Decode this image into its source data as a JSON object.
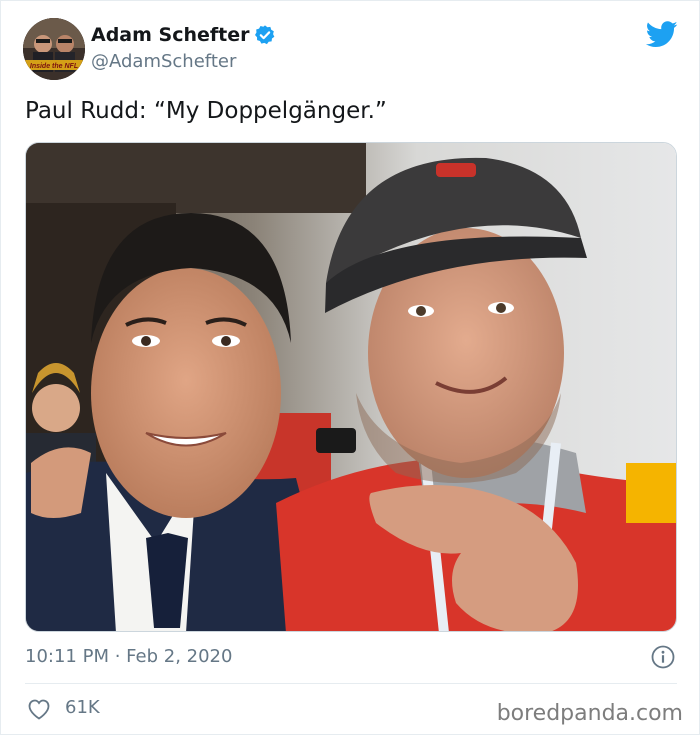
{
  "tweet": {
    "display_name": "Adam Schefter",
    "verified": true,
    "handle": "@AdamSchefter",
    "text": "Paul Rudd: “My Doppelgänger.”",
    "timestamp": "10:11 PM · Feb 2, 2020",
    "like_count": "61K",
    "avatar_logo_text": "Inside the NFL"
  },
  "icons": {
    "brand": "twitter-bird-icon",
    "verified": "verified-badge-icon",
    "info": "info-icon",
    "like": "heart-icon"
  },
  "colors": {
    "twitter_blue": "#1da1f2",
    "text_primary": "#14171a",
    "text_secondary": "#657786"
  },
  "watermark": {
    "text": "boredpanda.com"
  }
}
